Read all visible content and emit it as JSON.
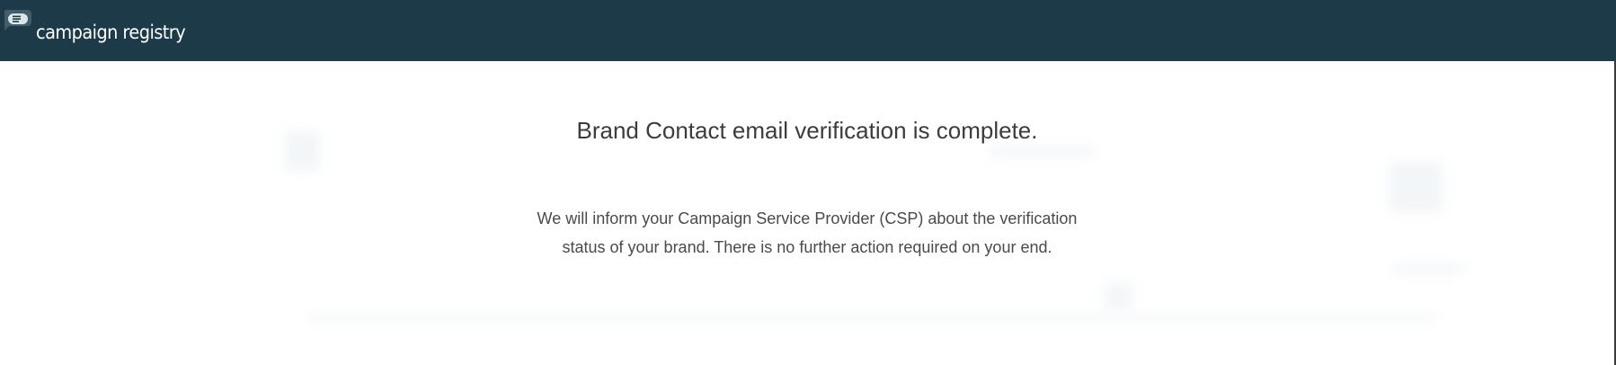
{
  "header": {
    "app_name": "campaign registry",
    "background_color": "#1c3a48",
    "logo_icon": "speech-bubble-list-icon"
  },
  "main": {
    "headline": "Brand Contact email verification is complete.",
    "message_line_1": "We will inform your Campaign Service Provider (CSP) about the verification",
    "message_line_2": "status of your brand. There is no further action required on your end."
  }
}
